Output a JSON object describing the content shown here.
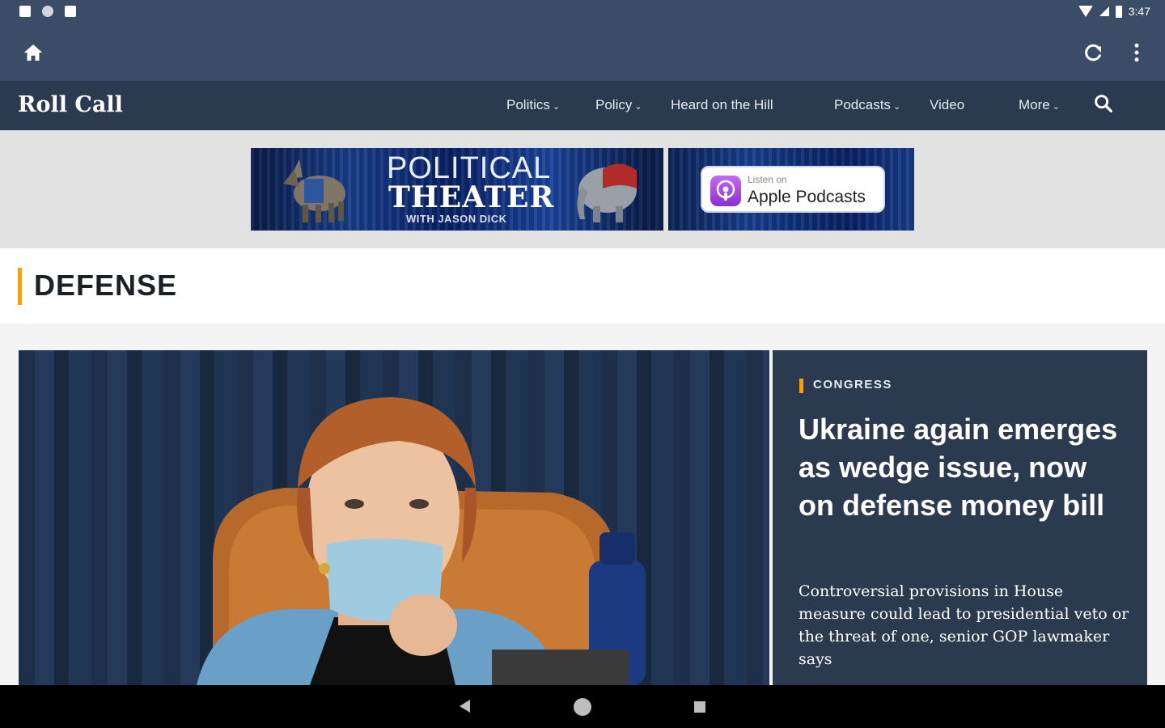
{
  "status_bar": {
    "time": "3:47"
  },
  "site": {
    "logo": "Roll Call"
  },
  "nav": {
    "items": [
      {
        "label": "Politics",
        "has_dropdown": true
      },
      {
        "label": "Policy",
        "has_dropdown": true
      },
      {
        "label": "Heard on the Hill",
        "has_dropdown": false
      },
      {
        "label": "Podcasts",
        "has_dropdown": true
      },
      {
        "label": "Video",
        "has_dropdown": false
      },
      {
        "label": "More",
        "has_dropdown": true
      }
    ],
    "chevron": "⌄"
  },
  "banner": {
    "line1": "POLITICAL",
    "line2": "THEATER",
    "line3": "WITH JASON DICK",
    "listen_on": "Listen on",
    "apple_podcasts": "Apple Podcasts"
  },
  "section": {
    "title": "DEFENSE"
  },
  "featured": {
    "category": "CONGRESS",
    "headline": "Ukraine again emerges as wedge issue, now on defense money bill",
    "dek": "Controversial provisions in House measure could lead to presidential veto or the threat of one, senior GOP lawmaker says"
  },
  "colors": {
    "toolbar": "#3b4c66",
    "site_nav": "#2c3a4f",
    "accent": "#f0a11c",
    "card": "#2c3a4f"
  }
}
